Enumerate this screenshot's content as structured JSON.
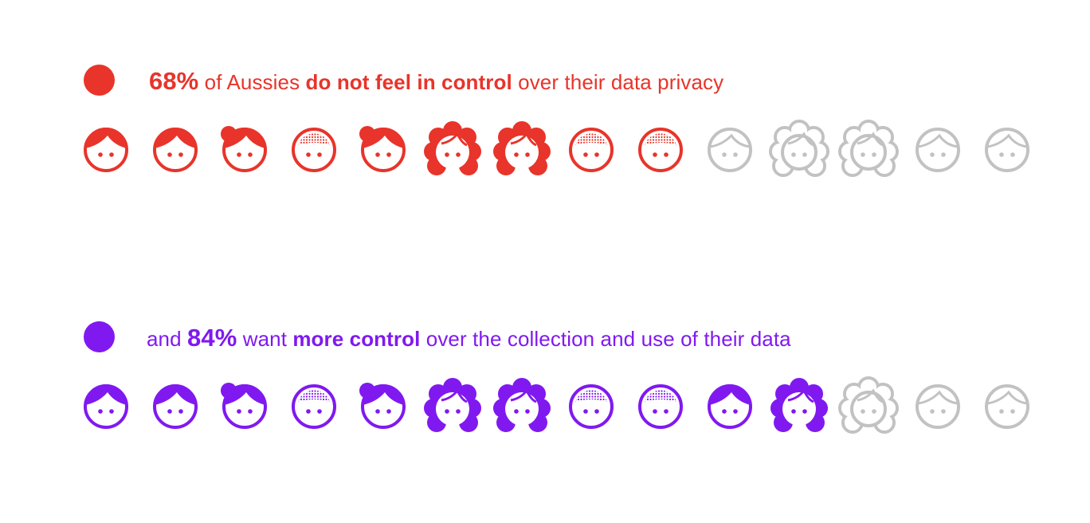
{
  "colors": {
    "stat1": "#e8342a",
    "stat2": "#8019f0",
    "inactive": "#c2c2c2"
  },
  "stats": [
    {
      "percent": "68%",
      "text_before": "",
      "text_middle": " of Aussies ",
      "emphasis": "do not feel in control",
      "text_after": " over their data privacy",
      "filled_icons": 9
    },
    {
      "percent": "84%",
      "text_before": "and ",
      "text_middle": " want ",
      "emphasis": "more control",
      "text_after": " over the collection and use of their data",
      "filled_icons": 11
    }
  ],
  "chart_data": {
    "type": "pictogram",
    "icons_per_row": 13,
    "icon_types": [
      "boy",
      "boy",
      "bun",
      "shaved",
      "bun",
      "curly",
      "curly",
      "shaved",
      "shaved",
      "boy",
      "curly",
      "curly",
      "boy",
      "boy"
    ],
    "series": [
      {
        "name": "do not feel in control over their data privacy",
        "value": 68,
        "unit": "%"
      },
      {
        "name": "want more control over the collection and use of their data",
        "value": 84,
        "unit": "%"
      }
    ]
  }
}
